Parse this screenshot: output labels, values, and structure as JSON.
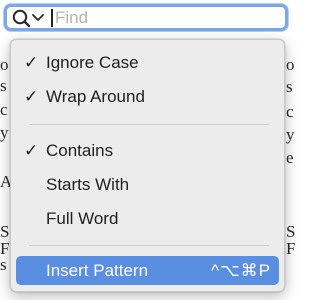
{
  "search": {
    "placeholder": "Find",
    "value": "",
    "options_icon": "magnifier-with-chevron-icon"
  },
  "menu": {
    "items": [
      {
        "label": "Ignore Case",
        "checked": true
      },
      {
        "label": "Wrap Around",
        "checked": true
      },
      {
        "label": "Contains",
        "checked": true
      },
      {
        "label": "Starts With",
        "checked": false
      },
      {
        "label": "Full Word",
        "checked": false
      },
      {
        "label": "Insert Pattern",
        "shortcut": "^⌥⌘P",
        "highlighted": true
      }
    ],
    "check_glyph": "✓"
  },
  "colors": {
    "accent": "#5a8ee0",
    "focus_ring": "#7aa7ea",
    "menu_bg": "#ececec"
  }
}
